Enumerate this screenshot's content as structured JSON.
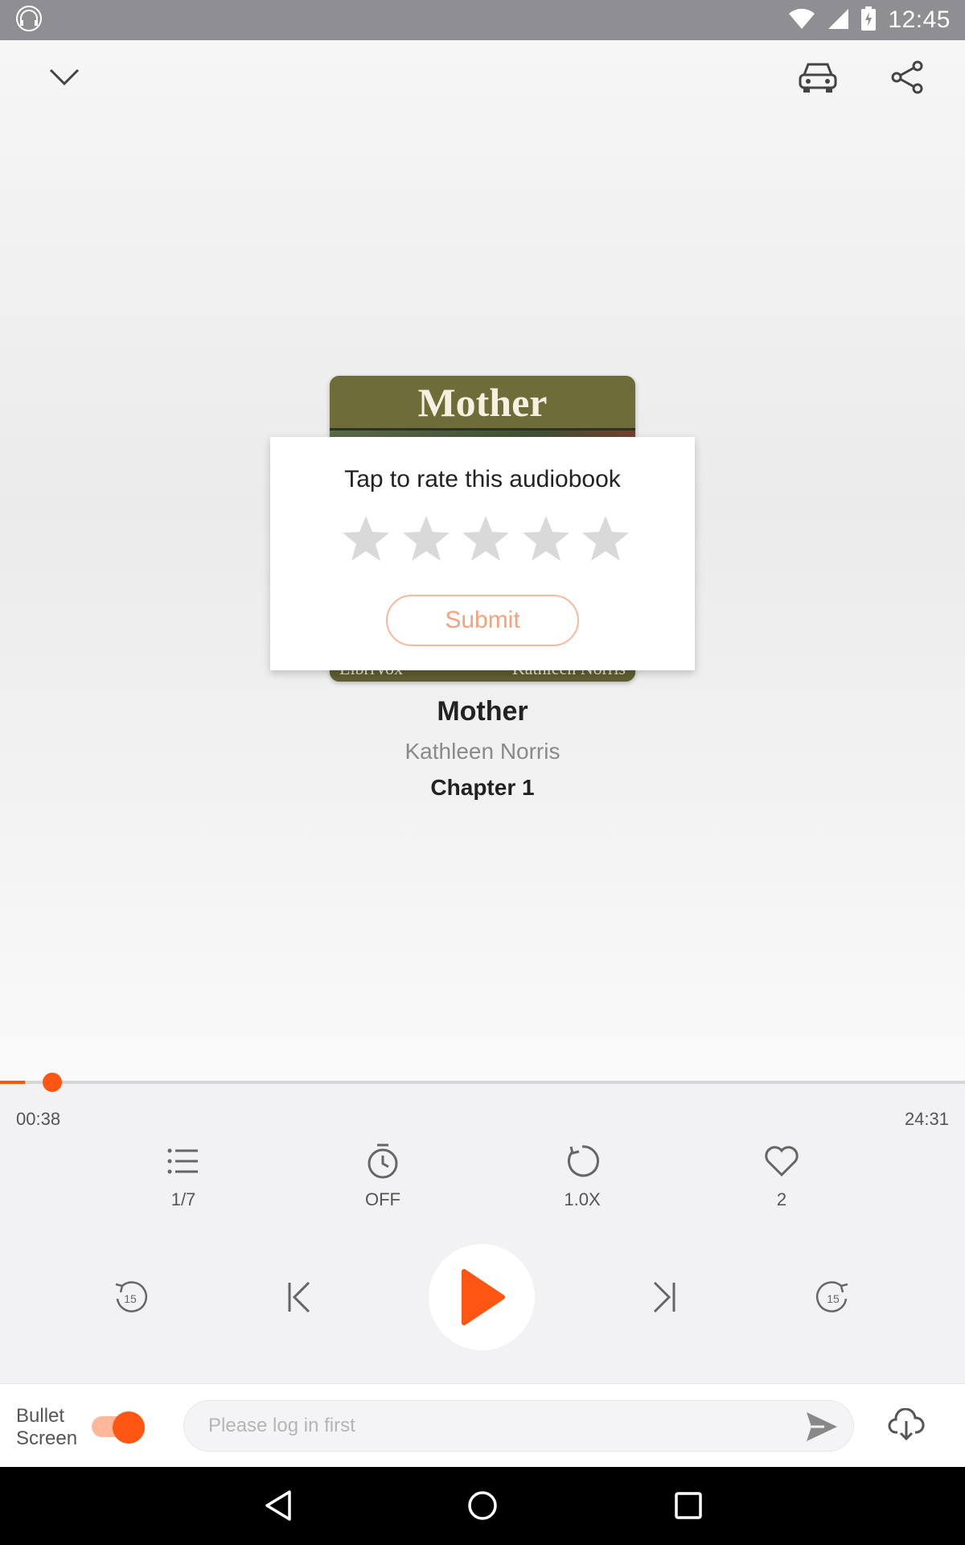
{
  "status_bar": {
    "time": "12:45"
  },
  "header": {
    "collapse_icon": "chevron-down-icon",
    "car_icon": "car-mode-icon",
    "share_icon": "share-icon"
  },
  "cover": {
    "title": "Mother",
    "bottom_left": "LibriVox",
    "bottom_right": "Kathleen Norris"
  },
  "rating_dialog": {
    "title": "Tap to rate this audiobook",
    "stars": 5,
    "selected": 0,
    "submit_label": "Submit"
  },
  "book": {
    "title": "Mother",
    "author": "Kathleen Norris",
    "chapter": "Chapter 1"
  },
  "progress": {
    "elapsed": "00:38",
    "duration": "24:31",
    "fraction": 0.026
  },
  "features": [
    {
      "icon": "playlist-icon",
      "label": "1/7"
    },
    {
      "icon": "timer-icon",
      "label": "OFF"
    },
    {
      "icon": "speed-icon",
      "label": "1.0X"
    },
    {
      "icon": "heart-icon",
      "label": "2"
    }
  ],
  "playback": {
    "rewind": "15",
    "forward": "15"
  },
  "comment_bar": {
    "bullet_label_1": "Bullet",
    "bullet_label_2": "Screen",
    "bullet_on": true,
    "placeholder": "Please log in first"
  },
  "colors": {
    "accent": "#ff5614",
    "accent_light": "#f7a17d"
  }
}
